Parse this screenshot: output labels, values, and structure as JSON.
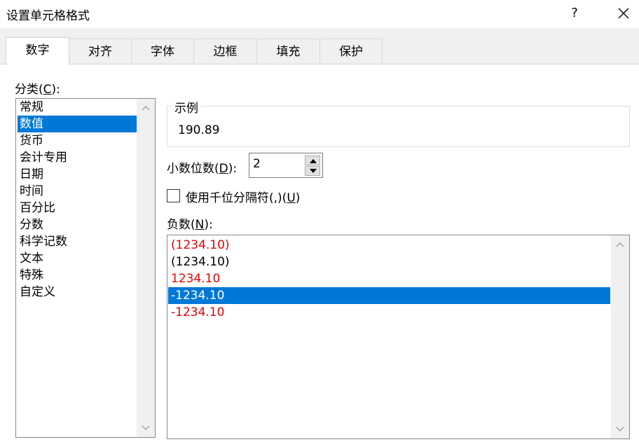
{
  "dialog": {
    "title": "设置单元格格式",
    "help": "?"
  },
  "tabs": [
    "数字",
    "对齐",
    "字体",
    "边框",
    "填充",
    "保护"
  ],
  "category": {
    "label_pre": "分类(",
    "label_key": "C",
    "label_post": "):",
    "items": [
      "常规",
      "数值",
      "货币",
      "会计专用",
      "日期",
      "时间",
      "百分比",
      "分数",
      "科学记数",
      "文本",
      "特殊",
      "自定义"
    ],
    "selected": "数值"
  },
  "sample": {
    "legend": "示例",
    "value": "190.89"
  },
  "decimals": {
    "label_pre": "小数位数(",
    "label_key": "D",
    "label_post": "):",
    "value": "2"
  },
  "thousands": {
    "label_pre": "使用千位分隔符(,)(",
    "label_key": "U",
    "label_post": ")",
    "checked": false
  },
  "negative": {
    "label_pre": "负数(",
    "label_key": "N",
    "label_post": "):",
    "items": [
      {
        "text": "(1234.10)",
        "color": "#e60000"
      },
      {
        "text": "(1234.10)",
        "color": "#000000"
      },
      {
        "text": "1234.10",
        "color": "#e60000"
      },
      {
        "text": "-1234.10",
        "color": "#ffffff"
      },
      {
        "text": "-1234.10",
        "color": "#e60000"
      }
    ],
    "selected": "-1234.10"
  },
  "colors": {
    "selection": "#0078d7",
    "negative_red": "#e60000"
  }
}
